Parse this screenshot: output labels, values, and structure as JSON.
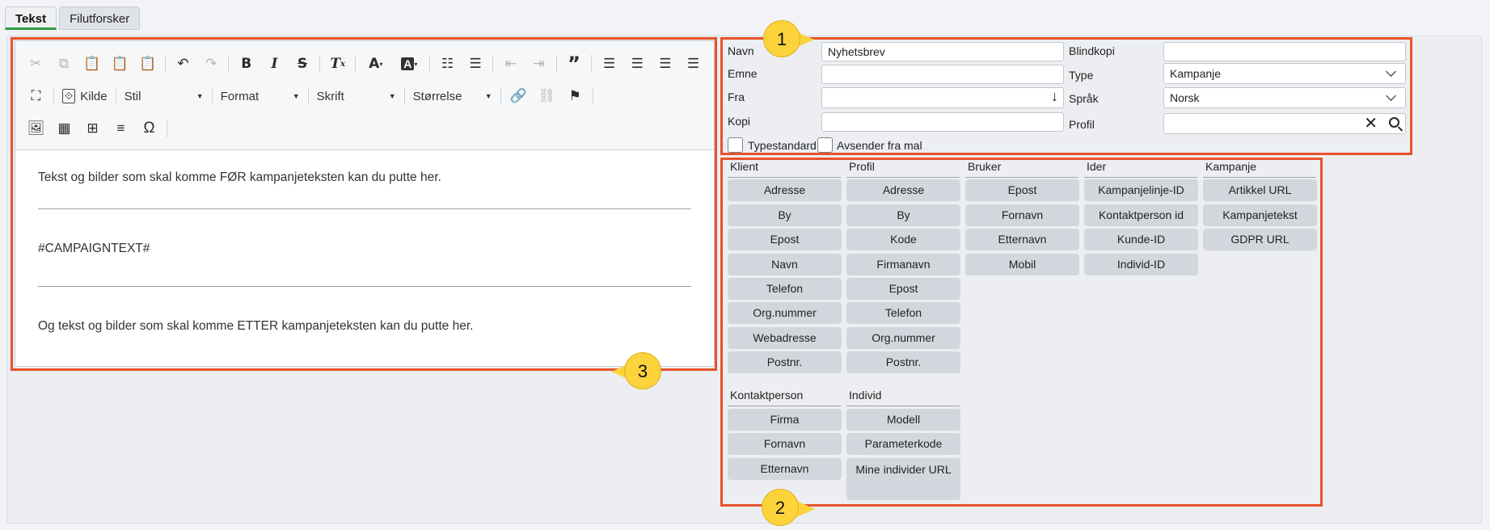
{
  "tabs": [
    {
      "label": "Tekst",
      "active": true
    },
    {
      "label": "Filutforsker",
      "active": false
    }
  ],
  "toolbar": {
    "kilde": "Kilde",
    "stil": "Stil",
    "format": "Format",
    "skrift": "Skrift",
    "storrelse": "Størrelse"
  },
  "editor": {
    "para1": "Tekst og bilder som skal komme FØR kampanjeteksten kan du putte her.",
    "placeholder": "#CAMPAIGNTEXT#",
    "para2": "Og tekst og bilder som skal komme ETTER kampanjeteksten kan du putte her."
  },
  "form": {
    "navn_label": "Navn",
    "navn_value": "Nyhetsbrev",
    "emne_label": "Emne",
    "emne_value": "",
    "fra_label": "Fra",
    "fra_value": "",
    "kopi_label": "Kopi",
    "kopi_value": "",
    "blindkopi_label": "Blindkopi",
    "blindkopi_value": "",
    "type_label": "Type",
    "type_value": "Kampanje",
    "sprak_label": "Språk",
    "sprak_value": "Norsk",
    "profil_label": "Profil",
    "profil_value": "",
    "typestandard_label": "Typestandard",
    "avsender_label": "Avsender fra mal"
  },
  "fields": {
    "klient": {
      "header": "Klient",
      "items": [
        "Adresse",
        "By",
        "Epost",
        "Navn",
        "Telefon",
        "Org.nummer",
        "Webadresse",
        "Postnr."
      ]
    },
    "profil": {
      "header": "Profil",
      "items": [
        "Adresse",
        "By",
        "Kode",
        "Firmanavn",
        "Epost",
        "Telefon",
        "Org.nummer",
        "Postnr."
      ]
    },
    "bruker": {
      "header": "Bruker",
      "items": [
        "Epost",
        "Fornavn",
        "Etternavn",
        "Mobil"
      ]
    },
    "ider": {
      "header": "Ider",
      "items": [
        "Kampanjelinje-ID",
        "Kontaktperson id",
        "Kunde-ID",
        "Individ-ID"
      ]
    },
    "kampanje": {
      "header": "Kampanje",
      "items": [
        "Artikkel URL",
        "Kampanjetekst",
        "GDPR URL"
      ]
    },
    "kontaktperson": {
      "header": "Kontaktperson",
      "items": [
        "Firma",
        "Fornavn",
        "Etternavn"
      ]
    },
    "individ": {
      "header": "Individ",
      "items": [
        "Modell",
        "Parameterkode",
        "Mine individer URL"
      ]
    }
  },
  "callouts": [
    "1",
    "2",
    "3"
  ],
  "colors": {
    "highlight": "#e8532a",
    "callout": "#fdd33c",
    "active_tab": "#2e9e44"
  }
}
